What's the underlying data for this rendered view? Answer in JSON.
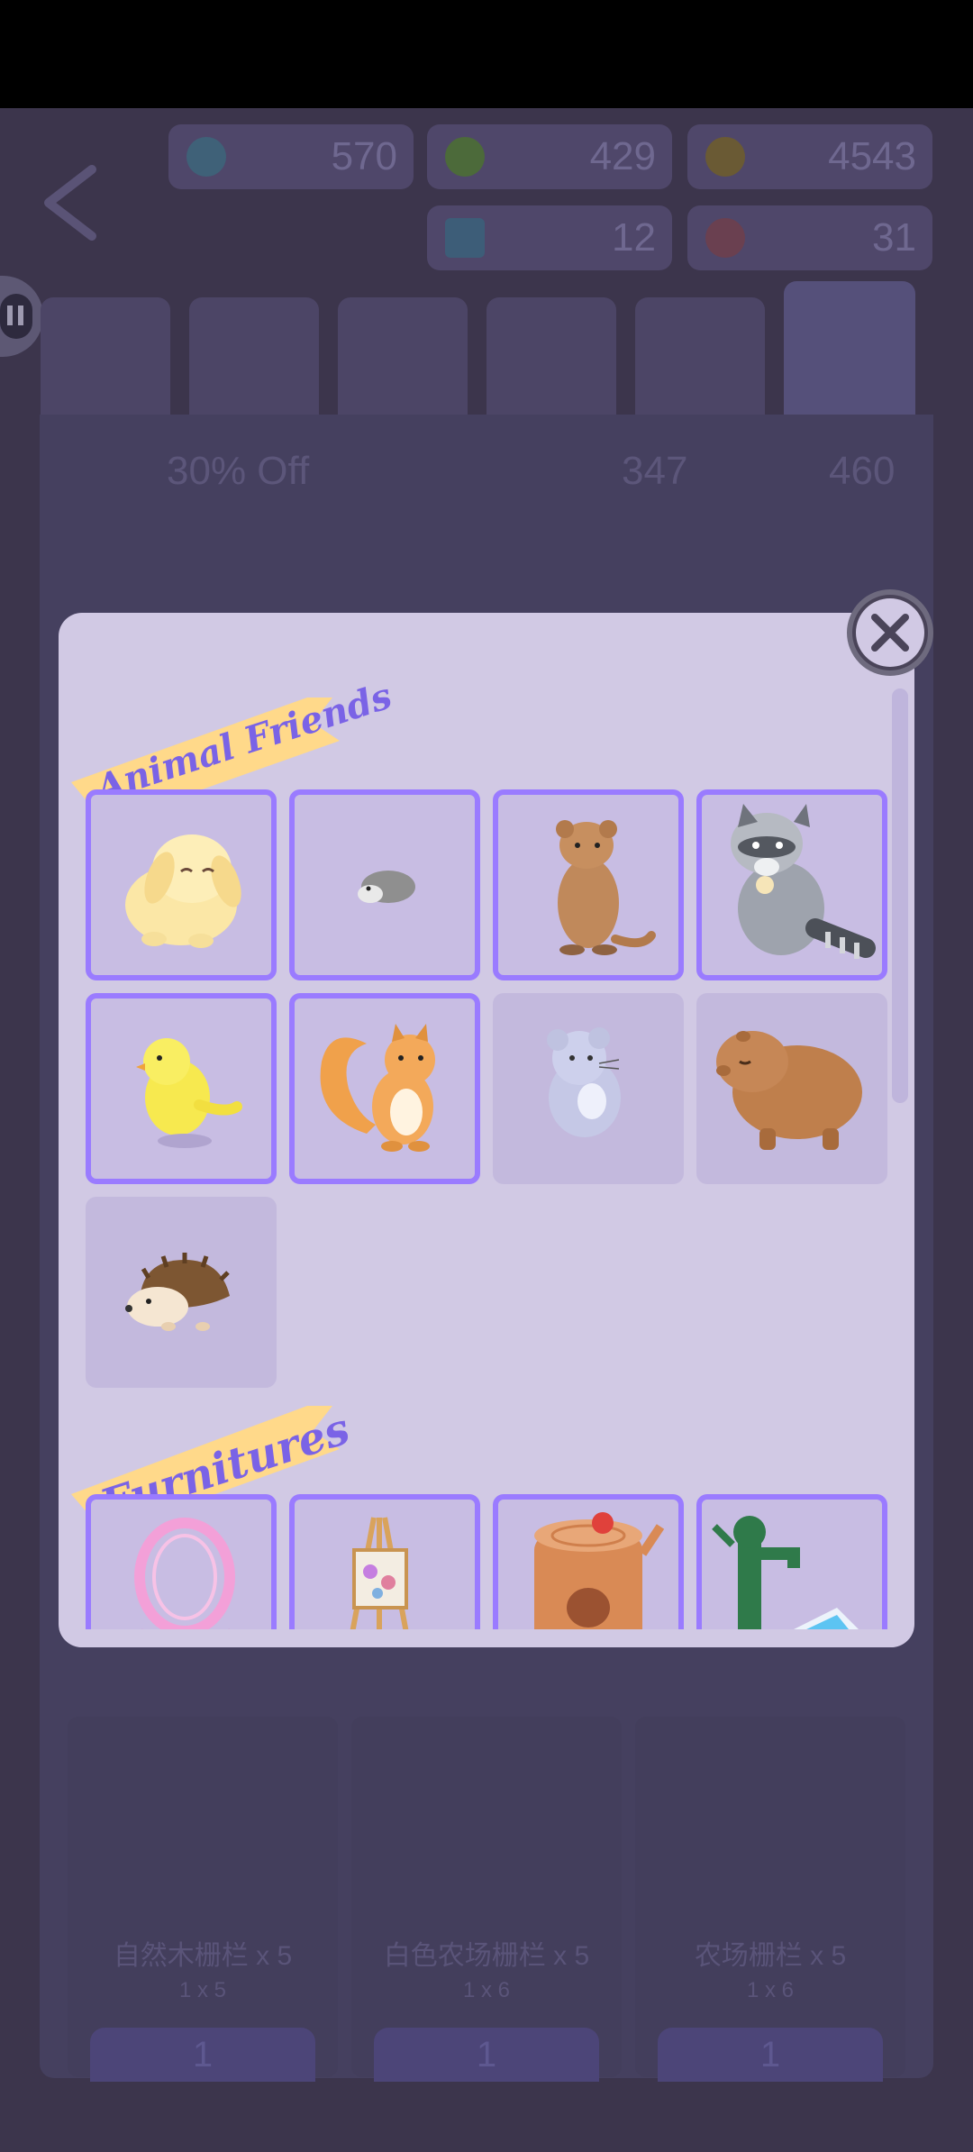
{
  "background": {
    "currencies": [
      "570",
      "429",
      "4543",
      "12",
      "31"
    ],
    "sale_label": "30% Off",
    "candy_count": "347",
    "ticket_count": "460",
    "shop_items": [
      {
        "name": "自然木栅栏 x 5",
        "qty": "1 x 5",
        "price": "1"
      },
      {
        "name": "白色农场栅栏 x 5",
        "qty": "1 x 6",
        "price": "1"
      },
      {
        "name": "农场栅栏 x 5",
        "qty": "1 x 6",
        "price": "1"
      }
    ]
  },
  "dialog": {
    "sections": [
      {
        "title": "Animal Friends",
        "items": [
          {
            "icon": "bunny-icon",
            "selected": true
          },
          {
            "icon": "hamster-icon",
            "selected": true
          },
          {
            "icon": "quokka-icon",
            "selected": true
          },
          {
            "icon": "raccoon-icon",
            "selected": true
          },
          {
            "icon": "chick-icon",
            "selected": true
          },
          {
            "icon": "squirrel-icon",
            "selected": true
          },
          {
            "icon": "chinchilla-icon",
            "selected": false
          },
          {
            "icon": "capybara-icon",
            "selected": false
          },
          {
            "icon": "hedgehog-icon",
            "selected": false
          }
        ]
      },
      {
        "title": "Furnitures",
        "items": [
          {
            "icon": "hamster-wheel-icon",
            "selected": true
          },
          {
            "icon": "easel-icon",
            "selected": true
          },
          {
            "icon": "tree-stump-icon",
            "selected": true
          },
          {
            "icon": "water-pump-icon",
            "selected": true
          }
        ]
      }
    ]
  },
  "colors": {
    "dialog_bg": "#d1c9e4",
    "banner": "#ffd98a",
    "banner_text": "#7a63e6",
    "selected_border": "#9a7bff",
    "overlay": "#3c354c"
  }
}
